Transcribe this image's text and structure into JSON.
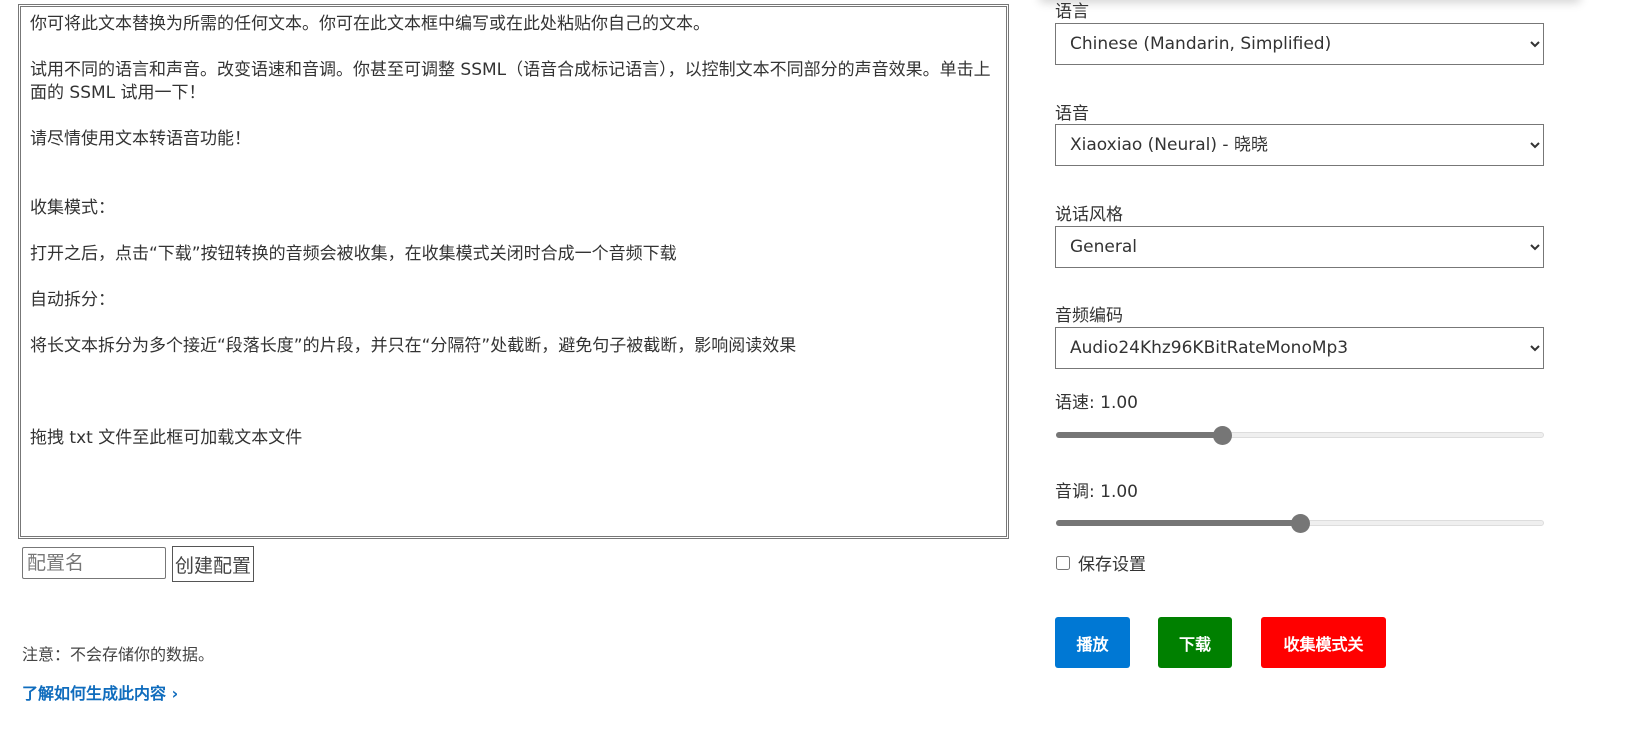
{
  "editor": {
    "text": "你可将此文本替换为所需的任何文本。你可在此文本框中编写或在此处粘贴你自己的文本。\n\n试用不同的语言和声音。改变语速和音调。你甚至可调整 SSML（语音合成标记语言），以控制文本不同部分的声音效果。单击上面的 SSML 试用一下！\n\n请尽情使用文本转语音功能！\n\n\n收集模式：\n\n打开之后，点击“下载”按钮转换的音频会被收集，在收集模式关闭时合成一个音频下载\n\n自动拆分：\n\n将长文本拆分为多个接近“段落长度”的片段，并只在“分隔符”处截断，避免句子被截断，影响阅读效果\n\n\n\n拖拽 txt 文件至此框可加载文本文件"
  },
  "config": {
    "placeholder": "配置名",
    "create_label": "创建配置"
  },
  "note": "注意：不会存储你的数据。",
  "learn_link": "了解如何生成此内容 ›",
  "settings": {
    "language_label": "语言",
    "language": "Chinese (Mandarin, Simplified)",
    "voice_label": "语音",
    "voice": "Xiaoxiao (Neural) - 晓晓",
    "style_label": "说话风格",
    "style": "General",
    "codec_label": "音频编码",
    "codec": "Audio24Khz96KBitRateMonoMp3",
    "rate_label": "语速: 1.00",
    "rate_fraction": 0.34,
    "pitch_label": "音调: 1.00",
    "pitch_fraction": 0.5,
    "save_label": "保存设置",
    "save_checked": false
  },
  "buttons": {
    "play": "播放",
    "download": "下载",
    "collect": "收集模式关"
  },
  "colors": {
    "play": "#0078d4",
    "download": "#008000",
    "collect": "#ff0000"
  }
}
